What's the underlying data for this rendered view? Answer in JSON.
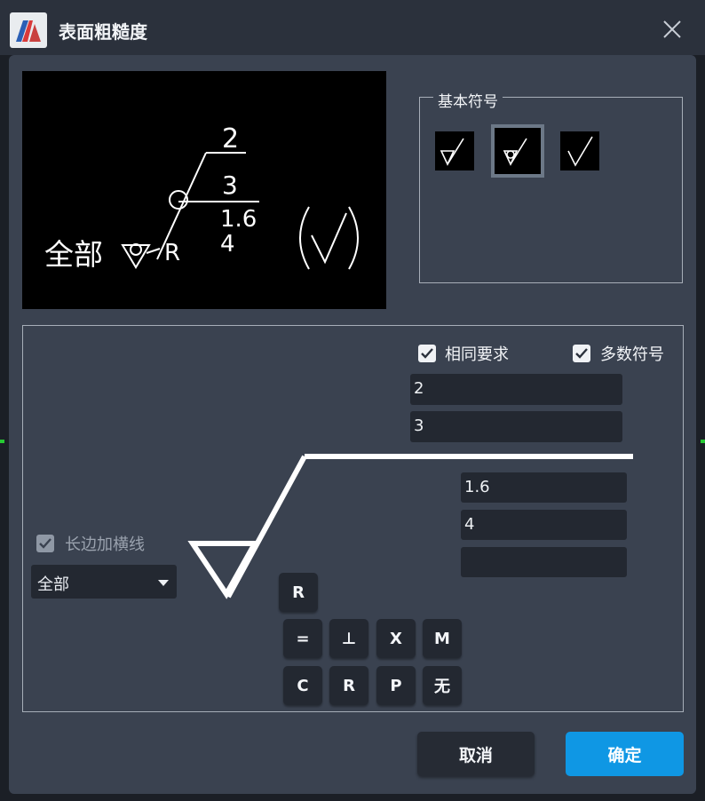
{
  "window": {
    "title": "表面粗糙度",
    "close_icon": "close-icon"
  },
  "preview": {
    "all_label": "全部",
    "value_top": "2",
    "value_mid": "3",
    "value_ra": "1.6",
    "value_bottom": "4",
    "process_letter": "R"
  },
  "basic_symbols": {
    "title": "基本符号",
    "items": [
      {
        "name": "material-removal-forbidden-symbol",
        "selected": false
      },
      {
        "name": "any-process-circle-symbol",
        "selected": true
      },
      {
        "name": "material-removal-symbol",
        "selected": false
      }
    ]
  },
  "options": {
    "same_requirement": {
      "label": "相同要求",
      "checked": true
    },
    "majority_symbol": {
      "label": "多数符号",
      "checked": true
    },
    "long_edge_line": {
      "label": "长边加横线",
      "checked": true,
      "disabled": true
    }
  },
  "fields": {
    "upper_1": "2",
    "upper_2": "3",
    "right_1": "1.6",
    "right_2": "4",
    "right_3": ""
  },
  "scope_select": {
    "value": "全部"
  },
  "keys": {
    "r_single": "R",
    "row1": [
      "=",
      "⊥",
      "X",
      "M"
    ],
    "row2": [
      "C",
      "R",
      "P",
      "无"
    ]
  },
  "buttons": {
    "cancel": "取消",
    "ok": "确定"
  },
  "colors": {
    "accent": "#0f97e4",
    "panel": "#3a4250",
    "field": "#232831"
  }
}
